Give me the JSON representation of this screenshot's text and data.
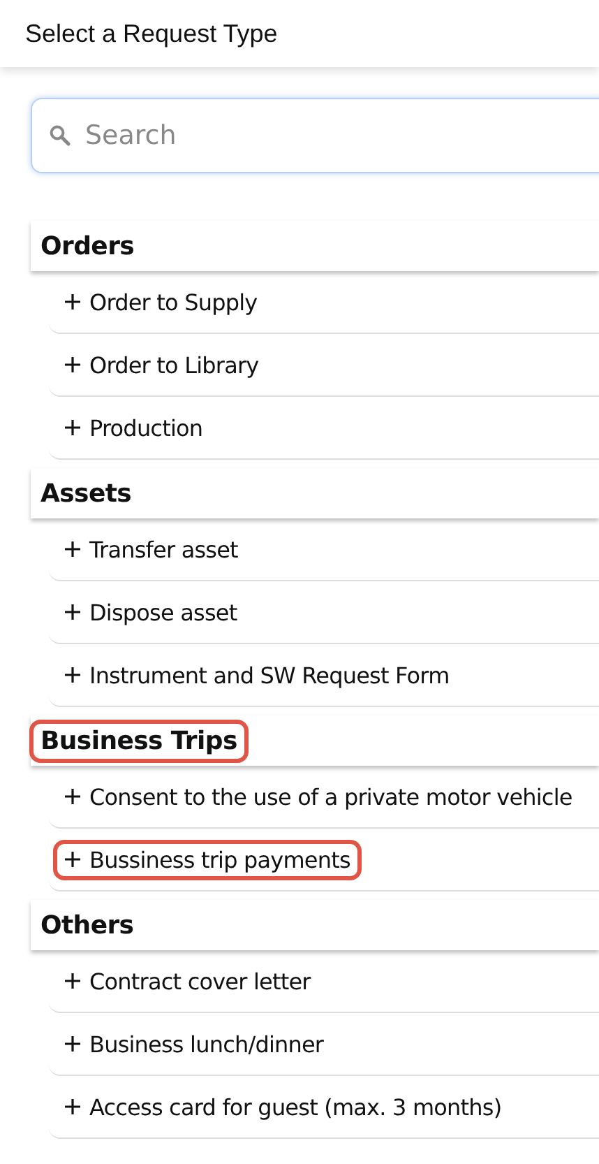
{
  "header": {
    "title": "Select a Request Type"
  },
  "search": {
    "placeholder": "Search"
  },
  "groups": [
    {
      "title": "Orders",
      "highlighted": false,
      "items": [
        {
          "label": "Order to Supply",
          "highlighted": false
        },
        {
          "label": "Order to Library",
          "highlighted": false
        },
        {
          "label": "Production",
          "highlighted": false
        }
      ]
    },
    {
      "title": "Assets",
      "highlighted": false,
      "items": [
        {
          "label": "Transfer asset",
          "highlighted": false
        },
        {
          "label": "Dispose asset",
          "highlighted": false
        },
        {
          "label": "Instrument and SW Request Form",
          "highlighted": false
        }
      ]
    },
    {
      "title": "Business Trips",
      "highlighted": true,
      "items": [
        {
          "label": "Consent to the use of a private motor vehicle",
          "highlighted": false
        },
        {
          "label": "Bussiness trip payments",
          "highlighted": true
        }
      ]
    },
    {
      "title": "Others",
      "highlighted": false,
      "items": [
        {
          "label": "Contract cover letter",
          "highlighted": false
        },
        {
          "label": "Business lunch/dinner",
          "highlighted": false
        },
        {
          "label": "Access card for guest (max. 3 months)",
          "highlighted": false
        }
      ]
    }
  ]
}
